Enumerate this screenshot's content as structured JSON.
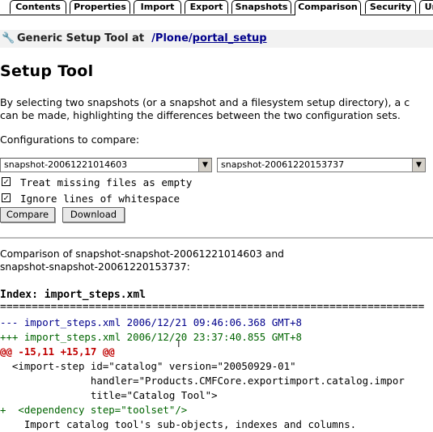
{
  "tabs": [
    {
      "label": "Contents",
      "active": false
    },
    {
      "label": "Properties",
      "active": false
    },
    {
      "label": "Import",
      "active": false
    },
    {
      "label": "Export",
      "active": false
    },
    {
      "label": "Snapshots",
      "active": false
    },
    {
      "label": "Comparison",
      "active": true
    },
    {
      "label": "Security",
      "active": false
    },
    {
      "label": "Un",
      "active": false
    }
  ],
  "header": {
    "prefix": "Generic Setup Tool at",
    "path_plain": "/Plone/",
    "path_link": "portal_setup"
  },
  "title": "Setup Tool",
  "description": {
    "line1": "By selecting two snapshots (or a snapshot and a filesystem setup directory), a c",
    "line2": "can be made, highlighting the differences between the two configuration sets."
  },
  "configs_label": "Configurations to compare:",
  "select_left": "snapshot-20061221014603",
  "select_right": "snapshot-20061220153737",
  "options": {
    "missing_files": {
      "label": "Treat missing files as empty",
      "checked": true
    },
    "whitespace": {
      "label": "Ignore lines of whitespace",
      "checked": true
    }
  },
  "buttons": {
    "compare": "Compare",
    "download": "Download"
  },
  "comparison": {
    "line1": "Comparison of snapshot-snapshot-20061221014603 and",
    "line2": "snapshot-snapshot-20061220153737:"
  },
  "index_title": "Index: import_steps.xml",
  "separator": "===================================================================",
  "diff": {
    "old_header": "--- import_steps.xml 2006/12/21 09:46:06.368 GMT+8",
    "new_header": "+++ import_steps.xml 2006/12/20 23:37:40.855 GMT+8",
    "hunk": "@@ -15,11 +15,17 @@",
    "lines": [
      "  <import-step id=\"catalog\" version=\"20050929-01\"",
      "               handler=\"Products.CMFCore.exportimport.catalog.impor",
      "               title=\"Catalog Tool\">",
      "+  <dependency step=\"toolset\"/>",
      "    Import catalog tool's sub-objects, indexes and columns."
    ]
  }
}
